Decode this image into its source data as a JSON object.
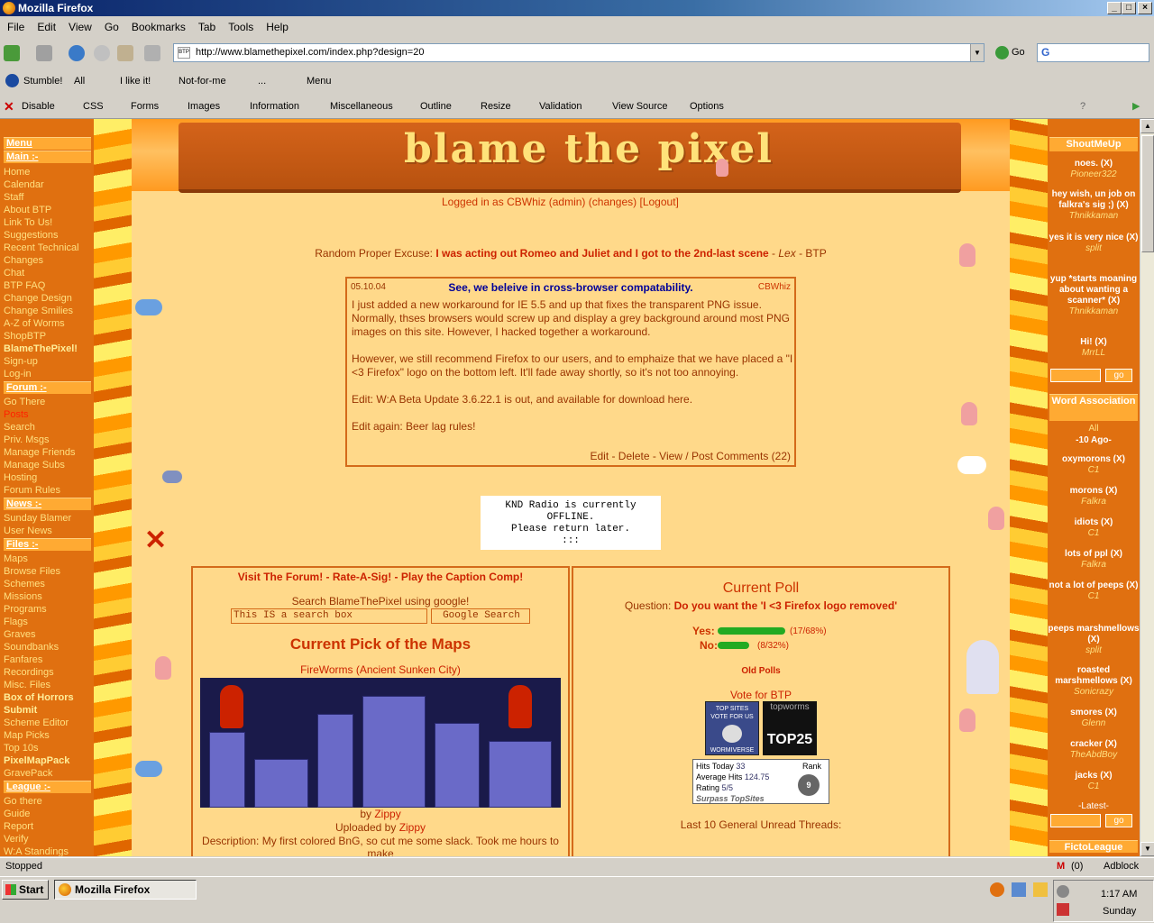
{
  "window": {
    "title": "Mozilla Firefox"
  },
  "menu": [
    "File",
    "Edit",
    "View",
    "Go",
    "Bookmarks",
    "Tab",
    "Tools",
    "Help"
  ],
  "nav": {
    "url": "http://www.blamethepixel.com/index.php?design=20",
    "go_label": "Go",
    "favicon_text": "BTP"
  },
  "stumble": {
    "stumble": "Stumble!",
    "all": "All",
    "like": "I like it!",
    "notforme": "Not-for-me",
    "comment": "...",
    "menu": "Menu"
  },
  "webdev": [
    "Disable",
    "CSS",
    "Forms",
    "Images",
    "Information",
    "Miscellaneous",
    "Outline",
    "Resize",
    "Validation",
    "View Source",
    "Options"
  ],
  "site": {
    "logo": "blame the pixel",
    "logged_in": {
      "prefix": "Logged in as",
      "user": "CBWhiz (admin)",
      "changes": "(changes)",
      "logout": "[Logout]"
    },
    "excuse": {
      "label": "Random Proper Excuse:",
      "text": "I was acting out Romeo and Juliet and I got to the 2nd-last scene",
      "sep": " - ",
      "author": "Lex",
      "suffix": " - BTP"
    }
  },
  "left_menu": {
    "menu_head": "Menu",
    "main_head": "Main :-",
    "main": [
      "Home",
      "Calendar",
      "Staff",
      "About BTP",
      "Link To Us!",
      "Suggestions",
      "Recent Technical",
      "Changes",
      "Chat",
      "BTP FAQ",
      "Change Design",
      "Change Smilies",
      "A-Z of Worms",
      "ShopBTP"
    ],
    "main_bold": "BlameThePixel!",
    "main2": [
      "Sign-up",
      "Log-in"
    ],
    "forum_head": "Forum :-",
    "forum": [
      "Go There"
    ],
    "forum_red": "Posts",
    "forum2": [
      "Search",
      "Priv. Msgs",
      "Manage Friends",
      "Manage Subs",
      "Hosting",
      "Forum Rules"
    ],
    "news_head": "News :-",
    "news": [
      "Sunday Blamer",
      "User News"
    ],
    "files_head": "Files :-",
    "files": [
      "Maps",
      "Browse Files",
      "Schemes",
      "Missions",
      "Programs",
      "Flags",
      "Graves",
      "Soundbanks",
      "Fanfares",
      "Recordings",
      "Misc. Files"
    ],
    "files_bold": [
      "Box of Horrors",
      "Submit"
    ],
    "files2": [
      "Scheme Editor",
      "Map Picks",
      "Top 10s"
    ],
    "files_bold2": "PixelMapPack",
    "files3": [
      "GravePack"
    ],
    "league_head": "League :-",
    "league": [
      "Go there",
      "Guide",
      "Report",
      "Verify",
      "W:A Standings"
    ]
  },
  "news": {
    "date": "05.10.04",
    "title": "See, we beleive in cross-browser compatability.",
    "author": "CBWhiz",
    "p1": "I just added a new workaround for IE 5.5 and up that fixes the transparent PNG issue. Normally, thses browsers would screw up and display a grey background around most PNG images on this site. However, I hacked together a workaround.",
    "p2": "However, we still recommend Firefox to our users, and to emphaize that we have placed a \"I <3 Firefox\" logo on the bottom left. It'll fade away shortly, so it's not too annoying.",
    "p3": "Edit: W:A Beta Update 3.6.22.1 is out, and available for download here.",
    "p4": "Edit again: Beer lag rules!",
    "actions": "Edit - Delete - View / Post Comments (22)"
  },
  "radio": {
    "line1": "KND Radio is currently",
    "line2": "OFFLINE.",
    "line3": "Please return later.",
    "line4": ":::"
  },
  "left_box": {
    "links": "Visit The Forum! - Rate-A-Sig! - Play the Caption Comp!",
    "search_label": "Search BlameThePixel using google!",
    "search_value": "This IS a search box",
    "search_button": "Google Search",
    "pick_title": "Current Pick of the Maps",
    "map_name": "FireWorms (Ancient Sunken City)",
    "by": "by",
    "by_user": "Zippy",
    "uploaded": "Uploaded by",
    "uploaded_user": "Zippy",
    "description": "Description: My first colored BnG, so cut me some slack. Took me hours to make"
  },
  "poll": {
    "title": "Current Poll",
    "question_label": "Question:",
    "question": "Do you want the 'I <3 Firefox logo removed'",
    "options": [
      {
        "label": "Yes:",
        "count": "(17/68%)",
        "fraction": 0.68
      },
      {
        "label": "No:",
        "count": "(8/32%)",
        "fraction": 0.32
      }
    ],
    "old": "Old Polls",
    "vote": "Vote for BTP",
    "topsites": {
      "line1": "TOP SITES",
      "line2": "VOTE FOR US",
      "footer": "WORMIVERSE"
    },
    "topworms": {
      "brand": "topworms",
      "rank": "TOP25"
    },
    "stats": {
      "hits_label": "Hits Today",
      "hits": "33",
      "avg_label": "Average Hits",
      "avg": "124.75",
      "rating_label": "Rating",
      "rating": "5/5",
      "rank_label": "Rank",
      "rank": "9",
      "brand": "Surpass TopSites"
    },
    "unread": "Last 10 General Unread Threads:"
  },
  "right": {
    "shout_head": "ShoutMeUp",
    "shouts": [
      {
        "msg": "noes.",
        "user": "Pioneer322"
      },
      {
        "msg": "hey wish, un job on falkra's sig ;)",
        "user": "Thnikkaman"
      },
      {
        "msg": "yes it is very nice",
        "user": "split"
      },
      {
        "msg": "yup *starts moaning about wanting a scanner*",
        "user": "Thnikkaman"
      },
      {
        "msg": "Hi!",
        "user": "MrrLL"
      }
    ],
    "go": "go",
    "word_head": "Word Association",
    "all": "All",
    "date": "-10 Ago-",
    "words": [
      {
        "word": "oxymorons",
        "user": "C1"
      },
      {
        "word": "morons",
        "user": "Falkra"
      },
      {
        "word": "idiots",
        "user": "C1"
      },
      {
        "word": "lots of ppl",
        "user": "Falkra"
      },
      {
        "word": "not a lot of peeps",
        "user": "C1"
      },
      {
        "word": "peeps marshmellows",
        "user": "split"
      },
      {
        "word": "roasted marshmellows",
        "user": "Sonicrazy"
      },
      {
        "word": "smores",
        "user": "Glenn"
      },
      {
        "word": "cracker",
        "user": "TheAbdBoy"
      },
      {
        "word": "jacks",
        "user": "C1"
      }
    ],
    "x": "(X)",
    "latest": "-Latest-",
    "ficto_head": "FictoLeague"
  },
  "status": {
    "text": "Stopped",
    "mail": "(0)",
    "adblock": "Adblock"
  },
  "taskbar": {
    "start": "Start",
    "item": "Mozilla Firefox",
    "time": "1:17 AM",
    "day": "Sunday"
  },
  "colors": {
    "page_orange": "#ff9900",
    "content_bg": "#ffd98a",
    "accent_red": "#cc2200",
    "link_blue": "#000099"
  }
}
